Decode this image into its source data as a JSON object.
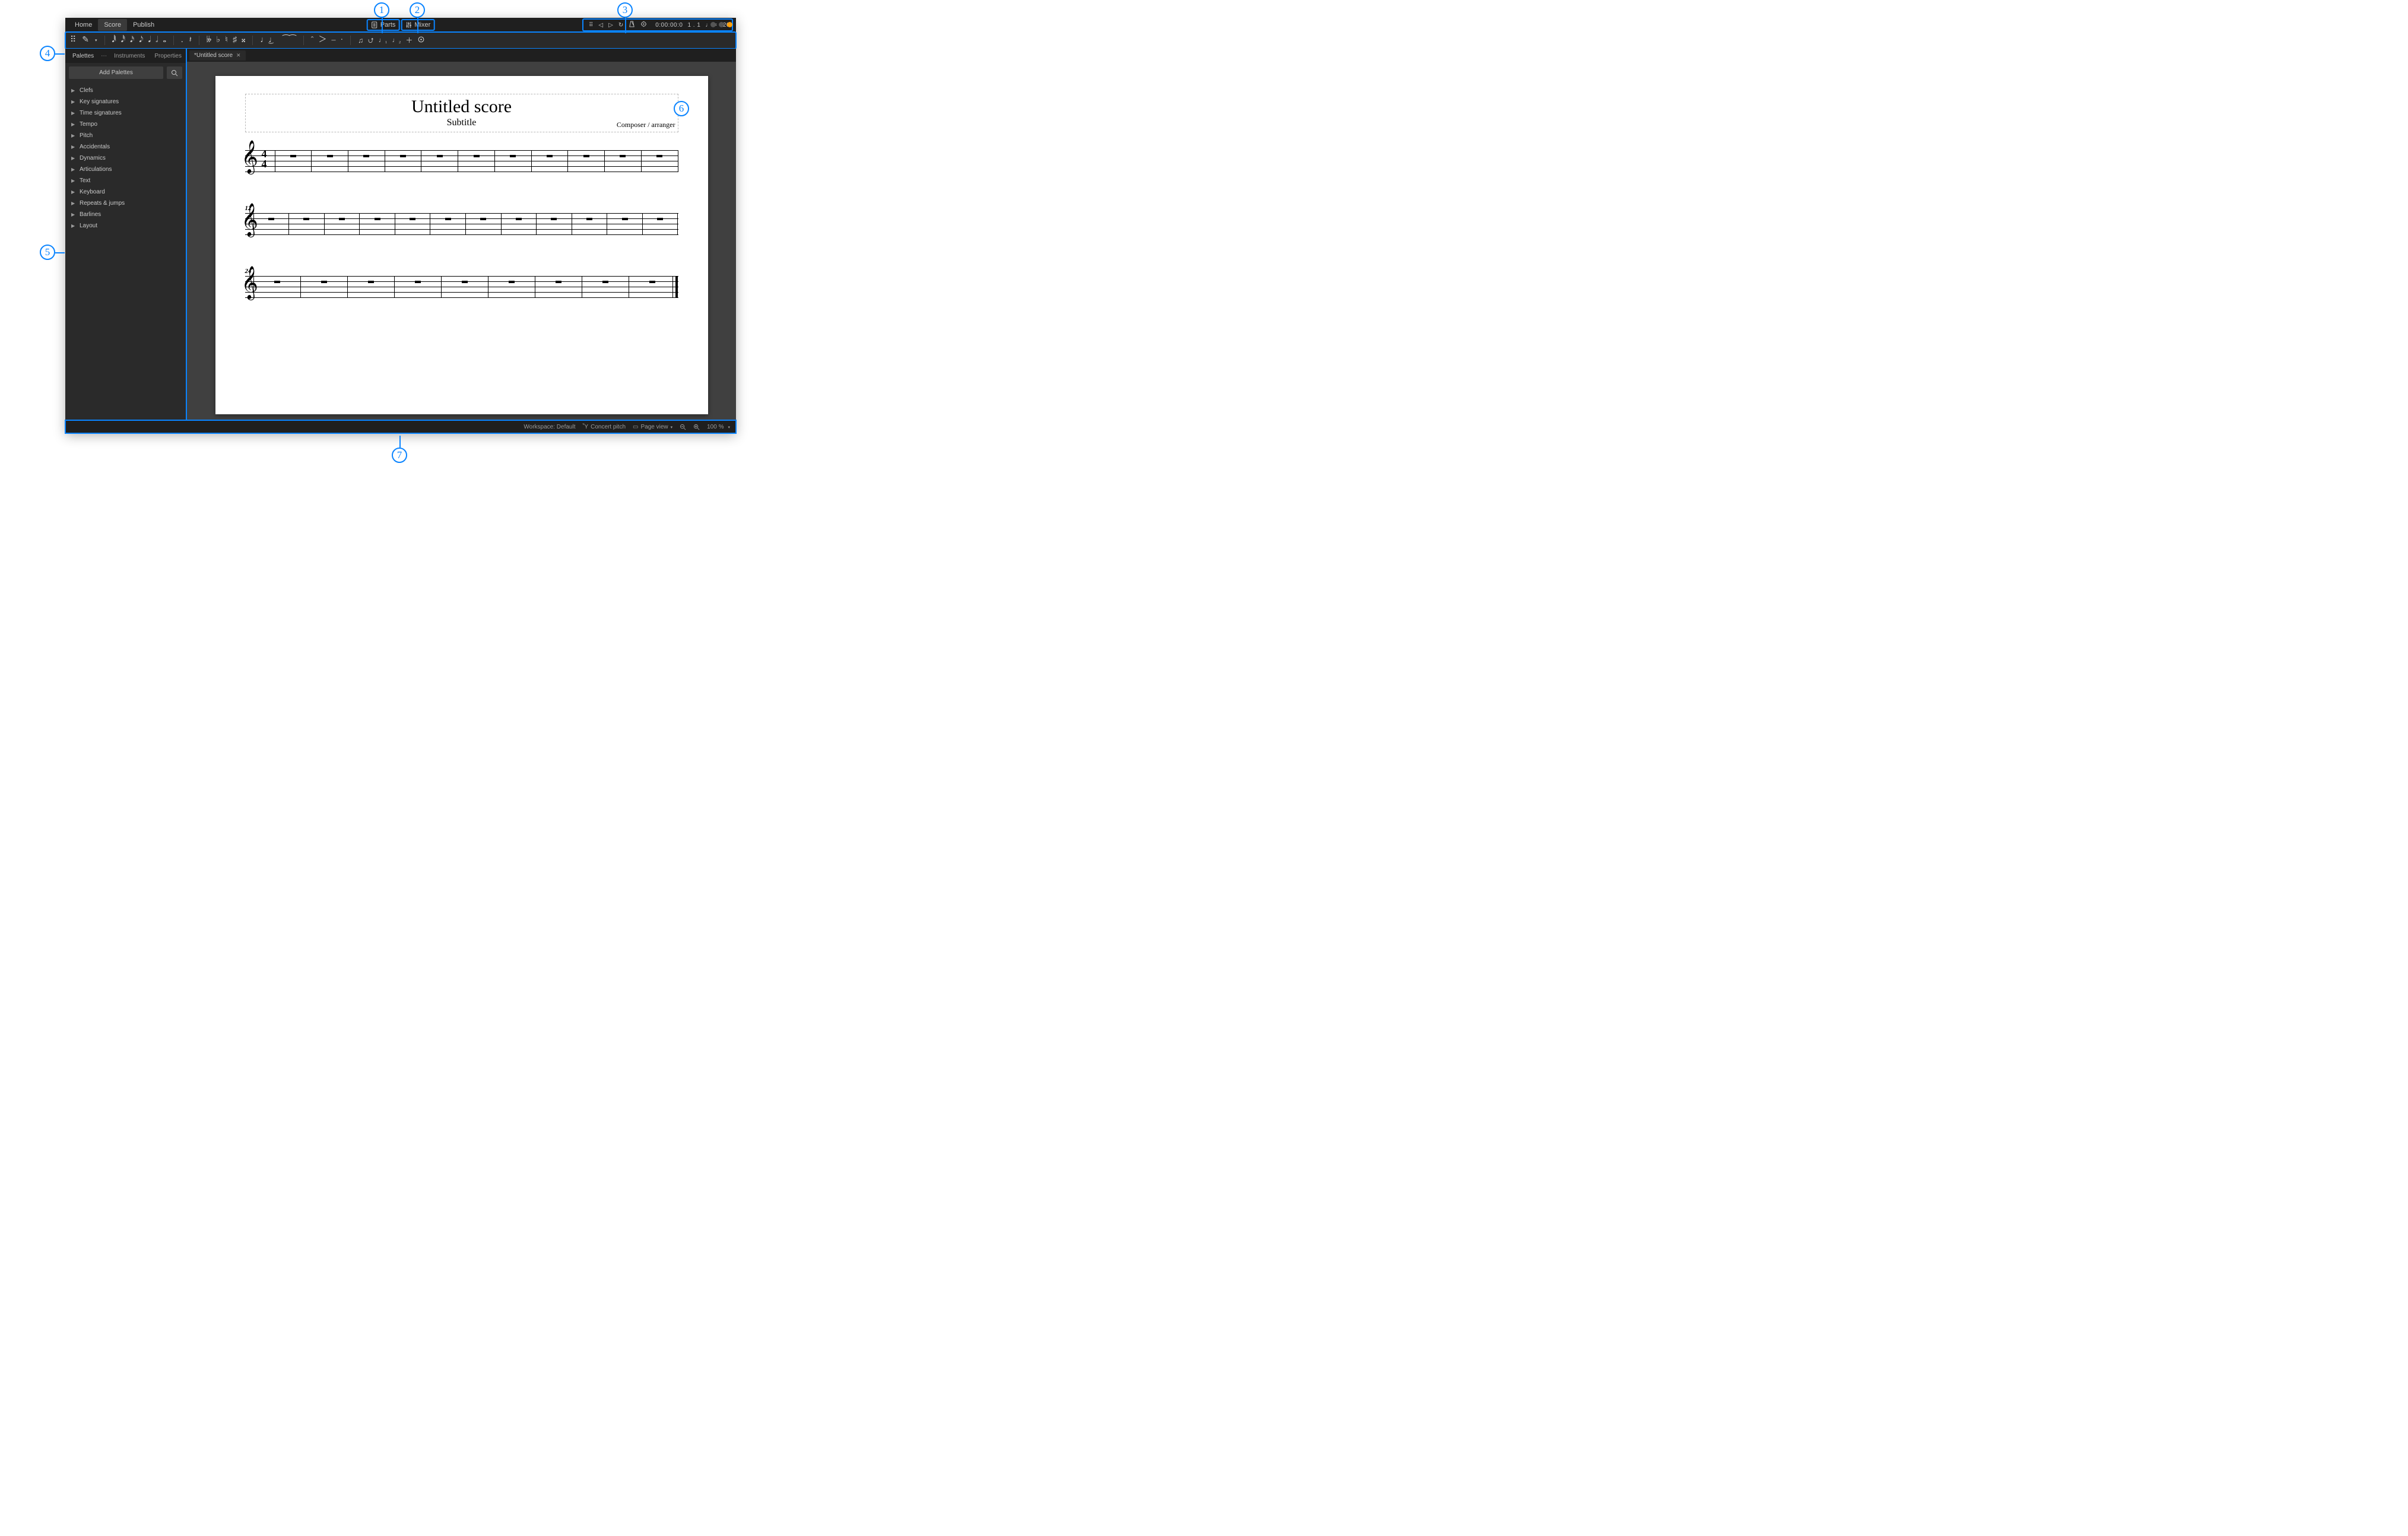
{
  "menu": {
    "items": [
      "Home",
      "Score",
      "Publish"
    ],
    "active": "Score",
    "parts_label": "Parts",
    "mixer_label": "Mixer",
    "time_readout": "0:00:00:0",
    "position_readout": "1 . 1",
    "tempo_readout": "♩ = 120"
  },
  "sidebar": {
    "tabs": [
      "Palettes",
      "Instruments",
      "Properties"
    ],
    "active_tab": "Palettes",
    "add_label": "Add Palettes",
    "tree": [
      "Clefs",
      "Key signatures",
      "Time signatures",
      "Tempo",
      "Pitch",
      "Accidentals",
      "Dynamics",
      "Articulations",
      "Text",
      "Keyboard",
      "Repeats & jumps",
      "Barlines",
      "Layout"
    ]
  },
  "tabstrip": {
    "file_name": "*Untitled score"
  },
  "score": {
    "title": "Untitled score",
    "subtitle": "Subtitle",
    "composer": "Composer / arranger",
    "systems": [
      {
        "number": "",
        "has_clef_sig": true,
        "bars": 11,
        "final": false
      },
      {
        "number": "12",
        "has_clef_sig": false,
        "bars": 12,
        "final": false
      },
      {
        "number": "24",
        "has_clef_sig": false,
        "bars": 9,
        "final": true
      }
    ]
  },
  "statusbar": {
    "workspace": "Workspace: Default",
    "concert_pitch": "Concert pitch",
    "page_view": "Page view",
    "zoom": "100 %"
  },
  "annotations": {
    "1": "1",
    "2": "2",
    "3": "3",
    "4": "4",
    "5": "5",
    "6": "6",
    "7": "7"
  }
}
